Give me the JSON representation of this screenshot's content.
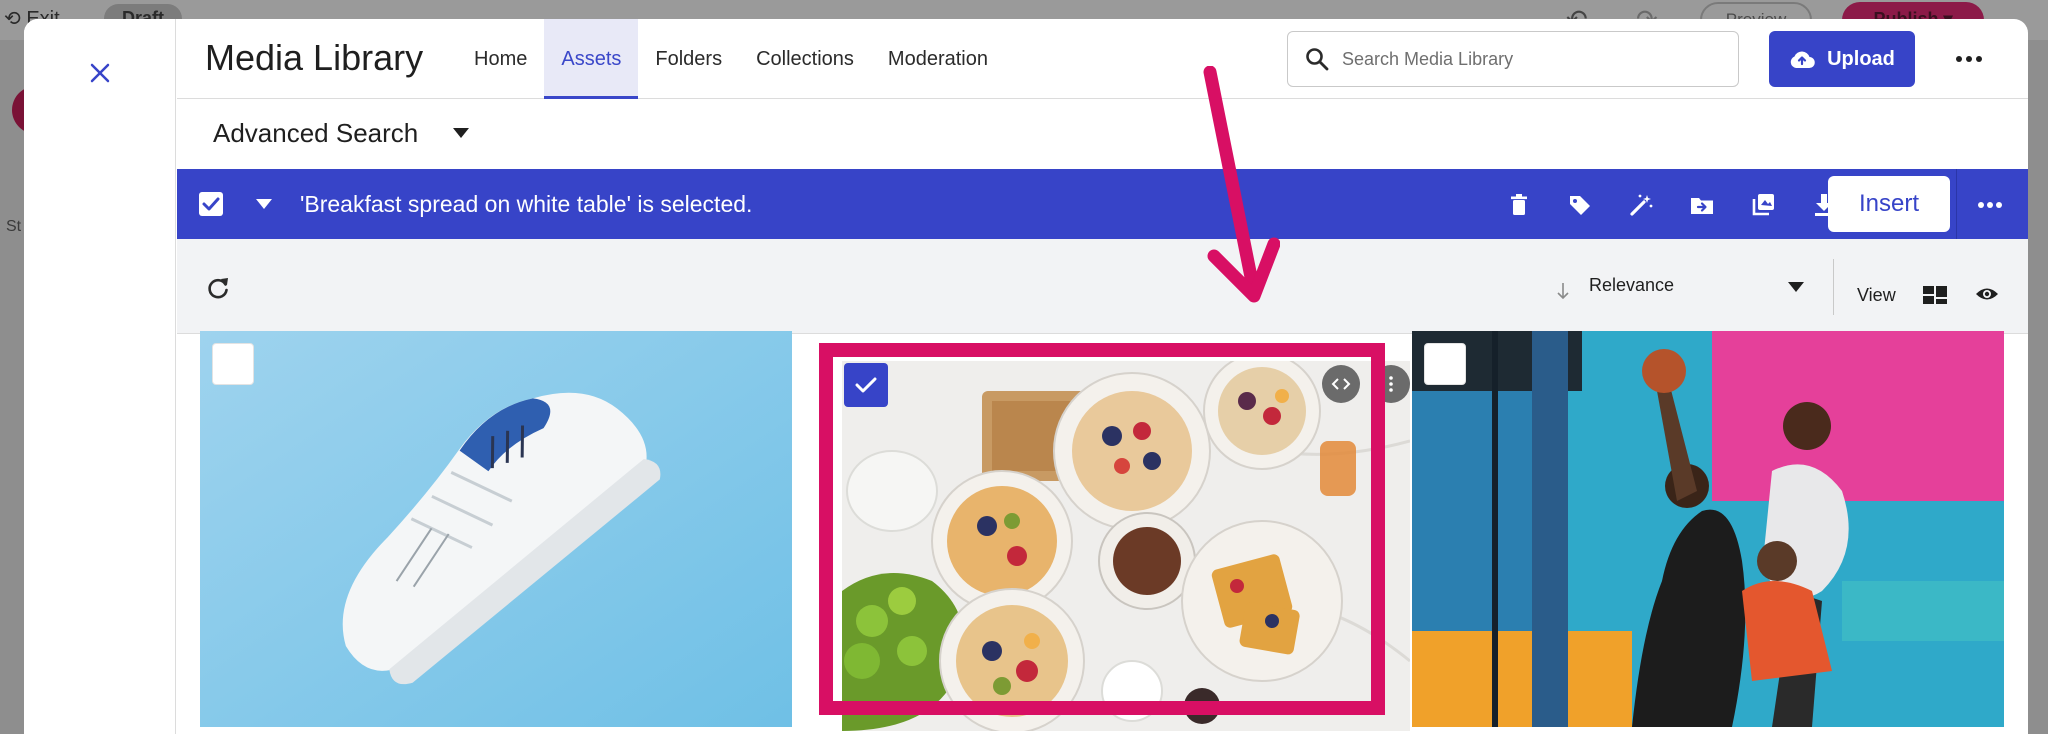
{
  "background": {
    "exit_label": "Exit",
    "draft_label": "Draft",
    "preview_label": "Preview",
    "publish_label": "Publish",
    "left_text": "St"
  },
  "header": {
    "title": "Media Library",
    "tabs": [
      {
        "label": "Home",
        "active": false
      },
      {
        "label": "Assets",
        "active": true
      },
      {
        "label": "Folders",
        "active": false
      },
      {
        "label": "Collections",
        "active": false
      },
      {
        "label": "Moderation",
        "active": false
      }
    ],
    "search_placeholder": "Search Media Library",
    "upload_label": "Upload"
  },
  "advanced_search": {
    "label": "Advanced Search"
  },
  "selection_bar": {
    "text": "'Breakfast spread on white table' is selected.",
    "insert_label": "Insert",
    "actions": [
      "trash-icon",
      "tag-icon",
      "magic-wand-icon",
      "move-to-folder-icon",
      "add-to-collection-icon",
      "download-icon"
    ]
  },
  "toolbar": {
    "sort_label": "Relevance",
    "view_label": "View"
  },
  "assets": [
    {
      "name": "white-sneaker",
      "selected": false
    },
    {
      "name": "breakfast-spread",
      "selected": true
    },
    {
      "name": "basketball-players",
      "selected": false
    }
  ],
  "colors": {
    "accent": "#3744c8",
    "annotation": "#d80f64"
  }
}
